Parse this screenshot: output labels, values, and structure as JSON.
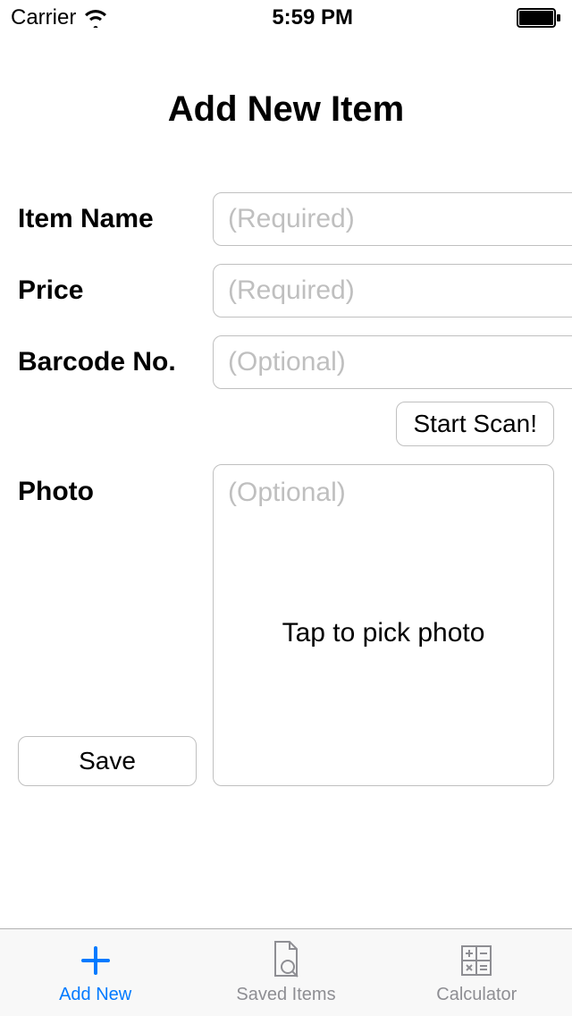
{
  "status": {
    "carrier": "Carrier",
    "time": "5:59 PM"
  },
  "page_title": "Add New Item",
  "fields": {
    "item_name": {
      "label": "Item Name",
      "placeholder": "(Required)",
      "value": ""
    },
    "price": {
      "label": "Price",
      "placeholder": "(Required)",
      "value": ""
    },
    "barcode": {
      "label": "Barcode No.",
      "placeholder": "(Optional)",
      "value": ""
    },
    "photo": {
      "label": "Photo",
      "placeholder": "(Optional)",
      "hint": "Tap to pick photo"
    }
  },
  "buttons": {
    "scan": "Start Scan!",
    "save": "Save"
  },
  "tabs": {
    "add_new": "Add New",
    "saved_items": "Saved Items",
    "calculator": "Calculator"
  },
  "colors": {
    "accent": "#007aff",
    "inactive": "#8e8e93"
  }
}
